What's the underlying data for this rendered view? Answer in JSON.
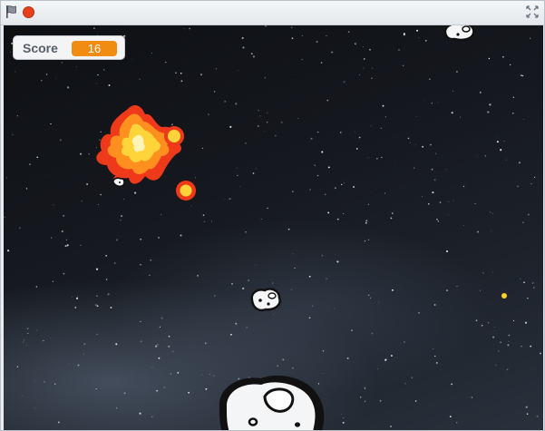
{
  "window": {
    "controls": {
      "flag_icon": "green-flag-icon",
      "stop_icon": "stop-sign-icon",
      "fullscreen_icon": "fullscreen-icon"
    }
  },
  "monitor": {
    "label": "Score",
    "value": "16"
  },
  "colors": {
    "score_badge": "#f08c12",
    "stop": "#e8401f",
    "space": "#121419",
    "fire_outer": "#ee3a1a",
    "fire_inner": "#ffe14a"
  },
  "sprites": [
    {
      "name": "asteroid-top-right",
      "icon": "asteroid-icon"
    },
    {
      "name": "explosion",
      "icon": "explosion-icon"
    },
    {
      "name": "asteroid-middle",
      "icon": "asteroid-icon"
    },
    {
      "name": "asteroid-large-bottom",
      "icon": "asteroid-icon"
    },
    {
      "name": "yellow-dot",
      "icon": "bullet-icon"
    }
  ]
}
